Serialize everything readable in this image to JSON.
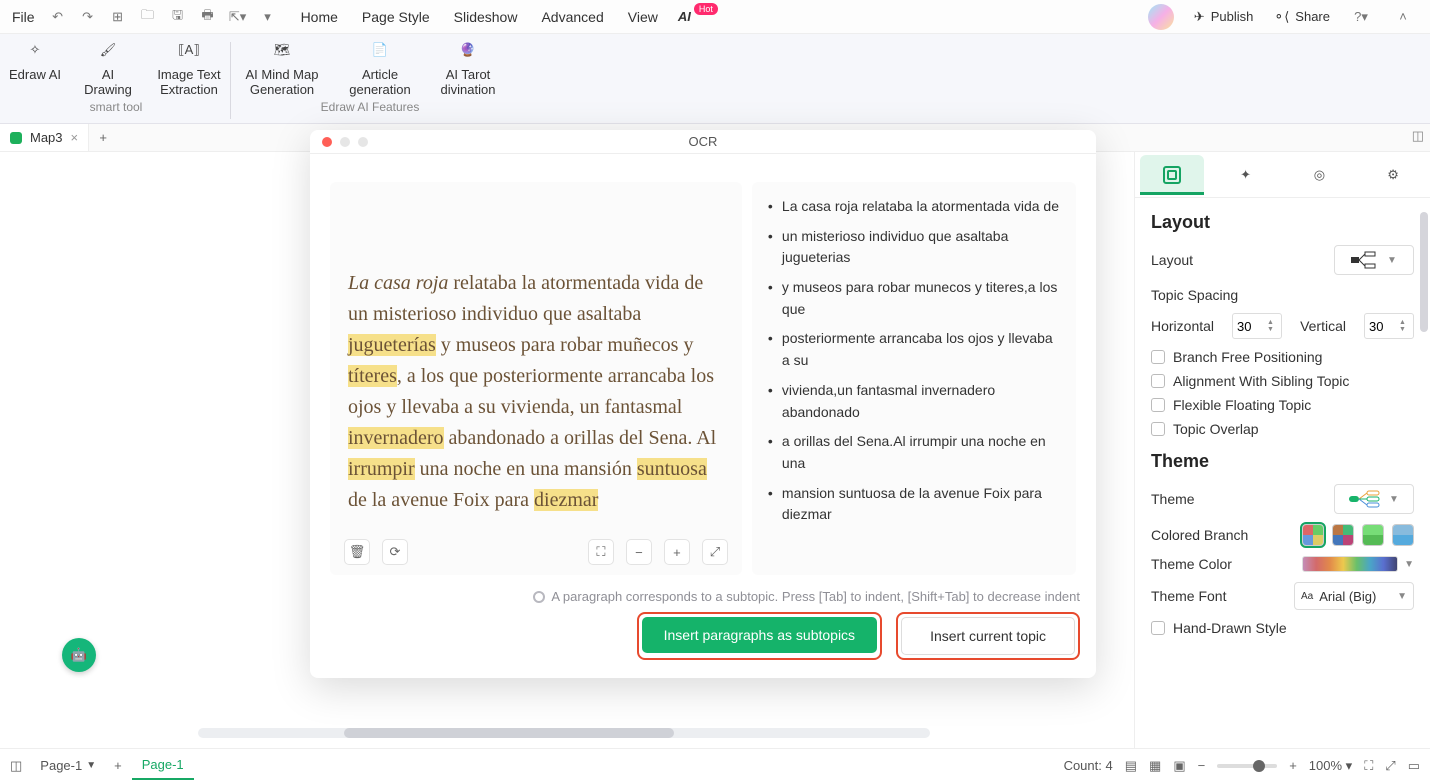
{
  "topbar": {
    "file": "File",
    "menu": [
      "Home",
      "Page Style",
      "Slideshow",
      "Advanced",
      "View"
    ],
    "ai_label": "AI",
    "ai_badge": "Hot",
    "publish": "Publish",
    "share": "Share"
  },
  "ribbon": {
    "group1_label": "smart tool",
    "group2_label": "Edraw AI Features",
    "items": [
      {
        "label": "Edraw AI"
      },
      {
        "label": "AI Drawing"
      },
      {
        "label": "Image Text Extraction"
      },
      {
        "label": "AI Mind Map Generation"
      },
      {
        "label": "Article generation"
      },
      {
        "label": "AI Tarot divination"
      }
    ]
  },
  "tabs": {
    "doc": "Map3"
  },
  "modal": {
    "title": "OCR",
    "paragraph_prefix_italic": "La casa roja",
    "paragraph_rest": " relataba la atormentada vida de un misterioso individuo que asaltaba ",
    "hl1": "jugueterías",
    "p2": " y museos para robar muñecos y ",
    "hl2": "títeres",
    "p3": ", a los que posteriormente arrancaba los ojos y llevaba a su vivienda, un fantasmal ",
    "hl3": "invernadero",
    "p4": " abandonado a orillas del Sena. Al ",
    "hl4": "irrumpir",
    "p5": " una noche en una mansión ",
    "hl5": "suntuosa",
    "p6": " de la avenue Foix para ",
    "hl6": "diezmar",
    "bullets": [
      "La casa roja relataba la atormentada vida de",
      "un misterioso individuo que asaltaba jugueterias",
      "y museos para robar munecos y titeres,a los que",
      "posteriormente arrancaba los ojos y llevaba a su",
      "vivienda,un fantasmal invernadero abandonado",
      "a orillas del Sena.Al irrumpir una noche en una",
      "mansion suntuosa de la avenue Foix para diezmar"
    ],
    "hint": "A paragraph corresponds to a subtopic. Press [Tab] to indent, [Shift+Tab] to decrease indent",
    "btn_primary": "Insert paragraphs as subtopics",
    "btn_secondary": "Insert current topic"
  },
  "panel": {
    "layout_title": "Layout",
    "layout_label": "Layout",
    "topic_spacing": "Topic Spacing",
    "horizontal": "Horizontal",
    "hv": "30",
    "vertical": "Vertical",
    "vv": "30",
    "chk_branch": "Branch Free Positioning",
    "chk_align": "Alignment With Sibling Topic",
    "chk_flex": "Flexible Floating Topic",
    "chk_overlap": "Topic Overlap",
    "theme_title": "Theme",
    "theme_label": "Theme",
    "colored_branch": "Colored Branch",
    "theme_color": "Theme Color",
    "theme_font": "Theme Font",
    "theme_font_val": "Arial (Big)",
    "chk_hand": "Hand-Drawn Style"
  },
  "status": {
    "page_sel": "Page-1",
    "page_active": "Page-1",
    "count": "Count: 4",
    "zoom": "100%"
  }
}
